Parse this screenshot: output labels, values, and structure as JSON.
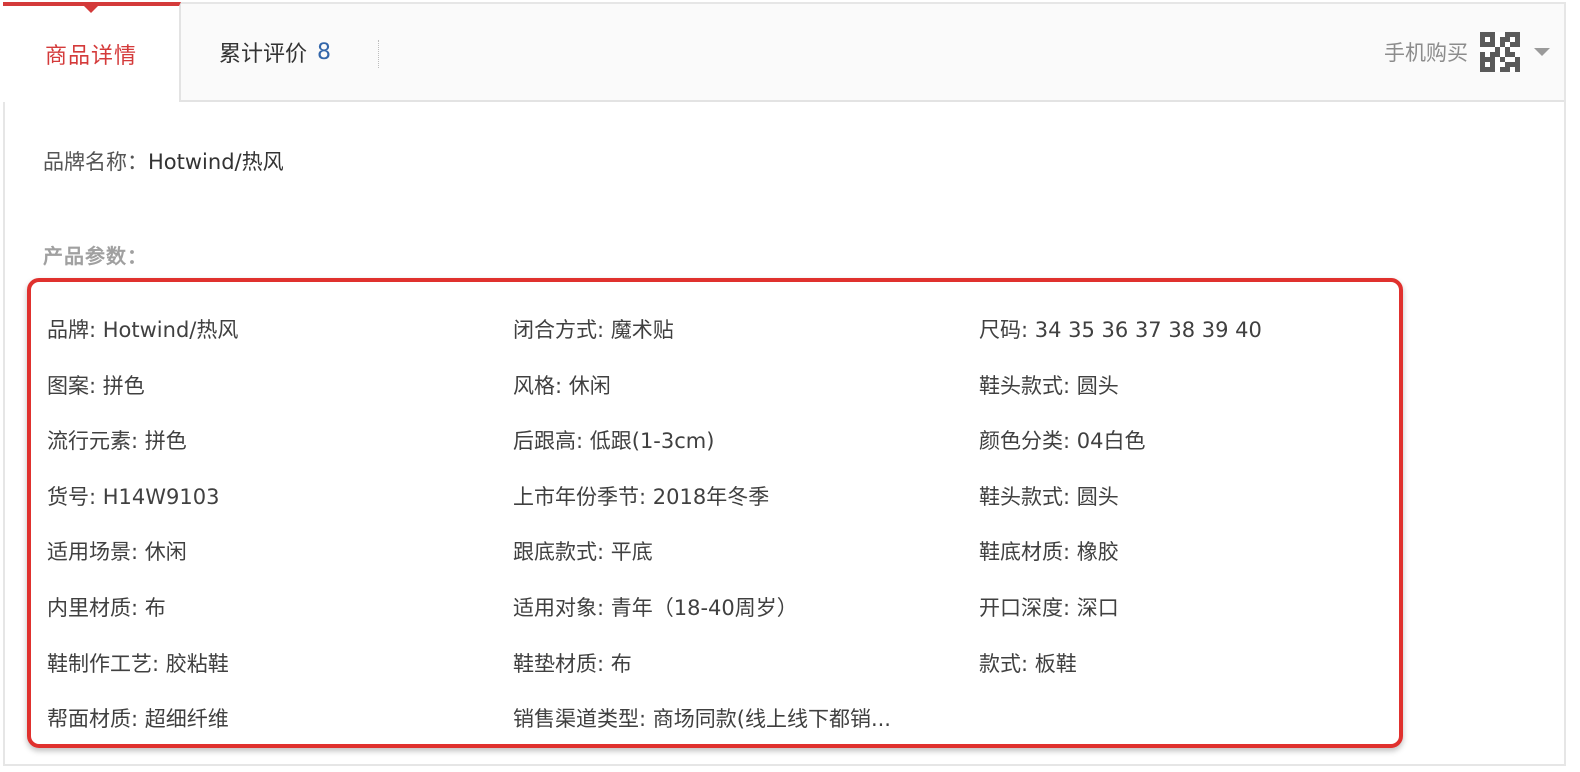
{
  "tabs": {
    "detail_label": "商品详情",
    "reviews_label": "累计评价",
    "reviews_count": "8",
    "mobile_buy_label": "手机购买"
  },
  "brand": {
    "key": "品牌名称：",
    "value": "Hotwind/热风"
  },
  "params_title": "产品参数：",
  "params": [
    "品牌: Hotwind/热风",
    "闭合方式: 魔术贴",
    "尺码: 34 35 36 37 38 39 40",
    "图案: 拼色",
    "风格: 休闲",
    "鞋头款式: 圆头",
    "流行元素: 拼色",
    "后跟高: 低跟(1-3cm)",
    "颜色分类: 04白色",
    "货号: H14W9103",
    "上市年份季节: 2018年冬季",
    "鞋头款式: 圆头",
    "适用场景: 休闲",
    "跟底款式: 平底",
    "鞋底材质: 橡胶",
    "内里材质: 布",
    "适用对象: 青年（18-40周岁）",
    "开口深度: 深口",
    "鞋制作工艺: 胶粘鞋",
    "鞋垫材质: 布",
    "款式: 板鞋",
    "帮面材质: 超细纤维",
    "销售渠道类型: 商场同款(线上线下都销..."
  ],
  "colors": {
    "accent": "#d43a3a",
    "highlight_box": "#e0312e",
    "count": "#3366aa",
    "muted": "#a0a0a0"
  },
  "icons": {
    "qr": "qr-code-icon",
    "dropdown": "chevron-down-icon"
  }
}
